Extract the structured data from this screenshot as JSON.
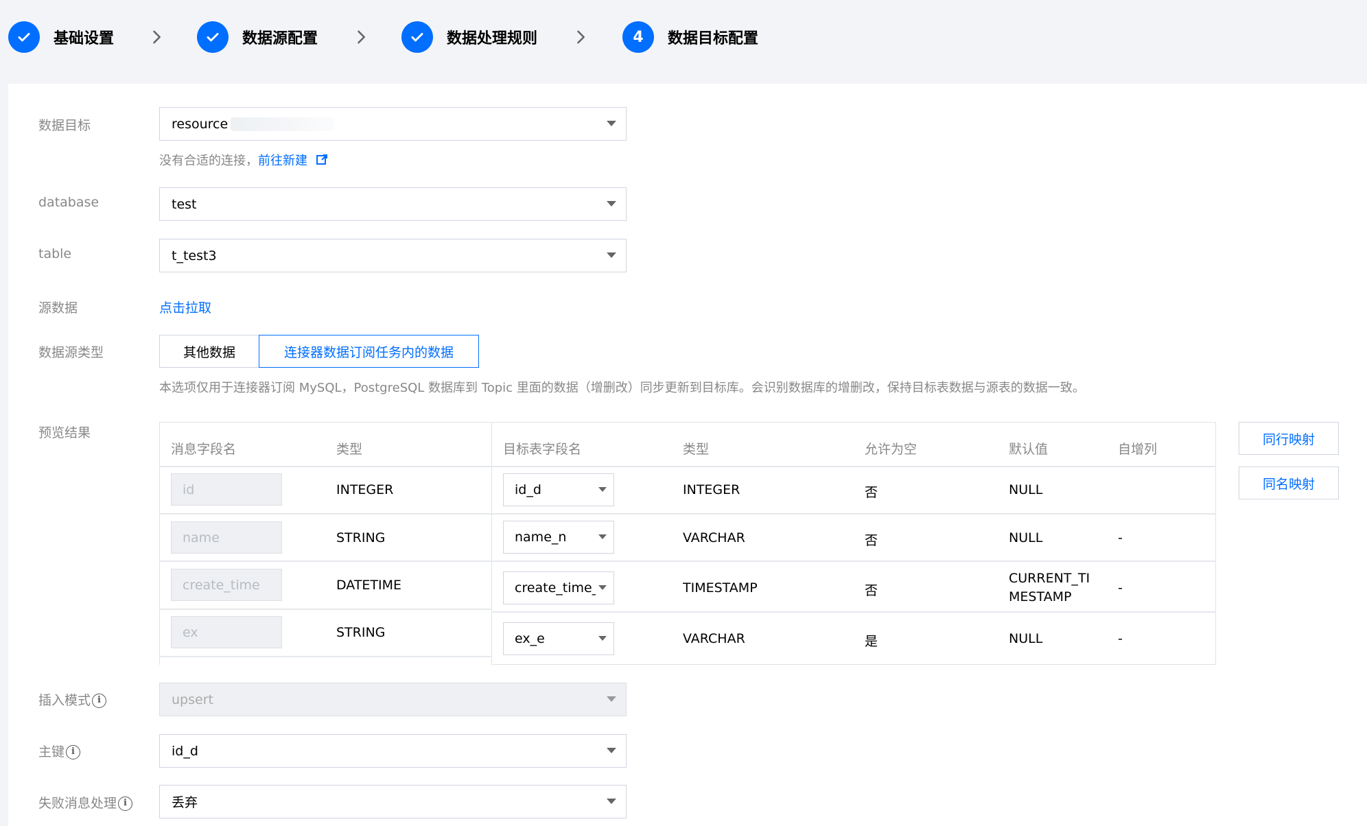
{
  "steps": [
    {
      "label": "基础设置",
      "state": "done"
    },
    {
      "label": "数据源配置",
      "state": "done"
    },
    {
      "label": "数据处理规则",
      "state": "done"
    },
    {
      "label": "数据目标配置",
      "state": "current",
      "number": "4"
    }
  ],
  "form": {
    "target": {
      "label": "数据目标",
      "value": "resource"
    },
    "no_connection_hint": "没有合适的连接，",
    "create_link": "前往新建",
    "database": {
      "label": "database",
      "value": "test"
    },
    "table": {
      "label": "table",
      "value": "t_test3"
    },
    "source_data": {
      "label": "源数据",
      "link": "点击拉取"
    },
    "source_type": {
      "label": "数据源类型",
      "options": [
        "其他数据",
        "连接器数据订阅任务内的数据"
      ],
      "selected": "连接器数据订阅任务内的数据",
      "hint": "本选项仅用于连接器订阅 MySQL，PostgreSQL 数据库到 Topic 里面的数据（增删改）同步更新到目标库。会识别数据库的增删改，保持目标表数据与源表的数据一致。"
    },
    "preview": {
      "label": "预览结果",
      "headers": {
        "msg_field": "消息字段名",
        "msg_type": "类型",
        "target_field": "目标表字段名",
        "target_type": "类型",
        "nullable": "允许为空",
        "default": "默认值",
        "autoinc": "自增列"
      },
      "rows": [
        {
          "src": "id",
          "src_type": "INTEGER",
          "dst": "id_d",
          "dst_type": "INTEGER",
          "nullable": "否",
          "default": "NULL",
          "autoinc": ""
        },
        {
          "src": "name",
          "src_type": "STRING",
          "dst": "name_n",
          "dst_type": "VARCHAR",
          "nullable": "否",
          "default": "NULL",
          "autoinc": "-"
        },
        {
          "src": "create_time",
          "src_type": "DATETIME",
          "dst": "create_time_",
          "dst_type": "TIMESTAMP",
          "nullable": "否",
          "default_line1": "CURRENT_TI",
          "default_line2": "MESTAMP",
          "autoinc": "-"
        },
        {
          "src": "ex",
          "src_type": "STRING",
          "dst": "ex_e",
          "dst_type": "VARCHAR",
          "nullable": "是",
          "default": "NULL",
          "autoinc": "-"
        }
      ],
      "map_same_row": "同行映射",
      "map_same_name": "同名映射"
    },
    "insert_mode": {
      "label": "插入模式",
      "value": "upsert"
    },
    "primary_key": {
      "label": "主键",
      "value": "id_d"
    },
    "fail_handling": {
      "label": "失败消息处理",
      "value": "丢弃"
    }
  },
  "colors": {
    "accent": "#006eff",
    "muted": "#888888",
    "border": "#cfd5de"
  }
}
